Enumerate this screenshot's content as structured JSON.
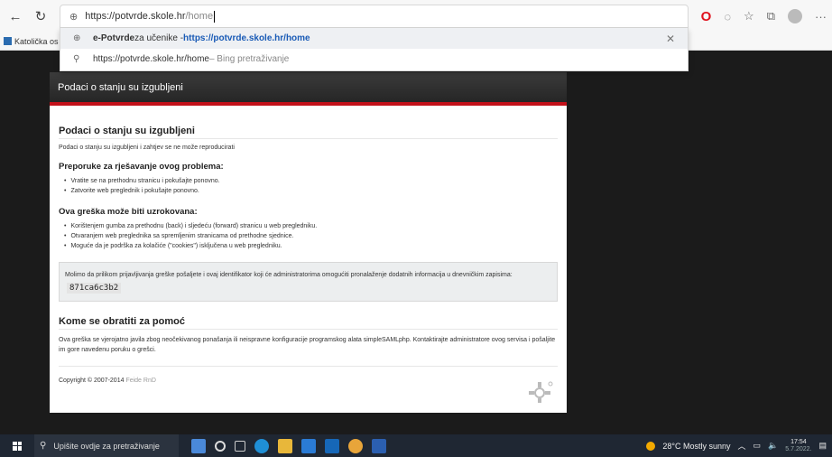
{
  "browser": {
    "address": {
      "host": "https://potvrde.skole.hr",
      "path": "/home"
    },
    "bookmark_label": "Katolička os"
  },
  "dropdown": {
    "item1": {
      "title_bold": "e-Potvrde",
      "title_rest": " za učenike - ",
      "url": "https://potvrde.skole.hr/home"
    },
    "item2": {
      "text": "https://potvrde.skole.hr/home",
      "suffix": " – Bing pretraživanje"
    }
  },
  "page": {
    "header_title": "Podaci o stanju su izgubljeni",
    "title": "Podaci o stanju su izgubljeni",
    "intro": "Podaci o stanju su izgubljeni i zahtjev se ne može reproducirati",
    "recommend_heading": "Preporuke za rješavanje ovog problema:",
    "recommendations": [
      "Vratite se na prethodnu stranicu i pokušajte ponovno.",
      "Zatvorite web preglednik i pokušajte ponovno."
    ],
    "causes_heading": "Ova greška može biti uzrokovana:",
    "causes": [
      "Korištenjem gumba za prethodnu (back) i sljedeću (forward) stranicu u web pregledniku.",
      "Otvaranjem web preglednika sa spremljenim stranicama od prethodne sjednice.",
      "Moguće da je podrška za kolačiće (\"cookies\") isključena u web pregledniku."
    ],
    "note_text": "Molimo da prilikom prijavljivanja greške pošaljete i ovaj identifikator koji će administratorima omogućiti pronalaženje dodatnih informacija u dnevničkim zapisima:",
    "track_id": "871ca6c3b2",
    "help_heading": "Kome se obratiti za pomoć",
    "help_text": "Ova greška se vjerojatno javila zbog neočekivanog ponašanja ili neispravne konfiguracije programskog alata simpleSAMLphp. Kontaktirajte administratore ovog servisa i pošaljite im gore navedenu poruku o grešci.",
    "copyright_text": "Copyright © 2007-2014 ",
    "copyright_link": "Feide RnD"
  },
  "taskbar": {
    "search_placeholder": "Upišite ovdje za pretraživanje",
    "weather": "28°C  Mostly sunny",
    "time": "17:54",
    "date": "5.7.2022."
  },
  "colors": {
    "accent_red": "#c3111a",
    "header_dark": "#2e2e2e"
  }
}
